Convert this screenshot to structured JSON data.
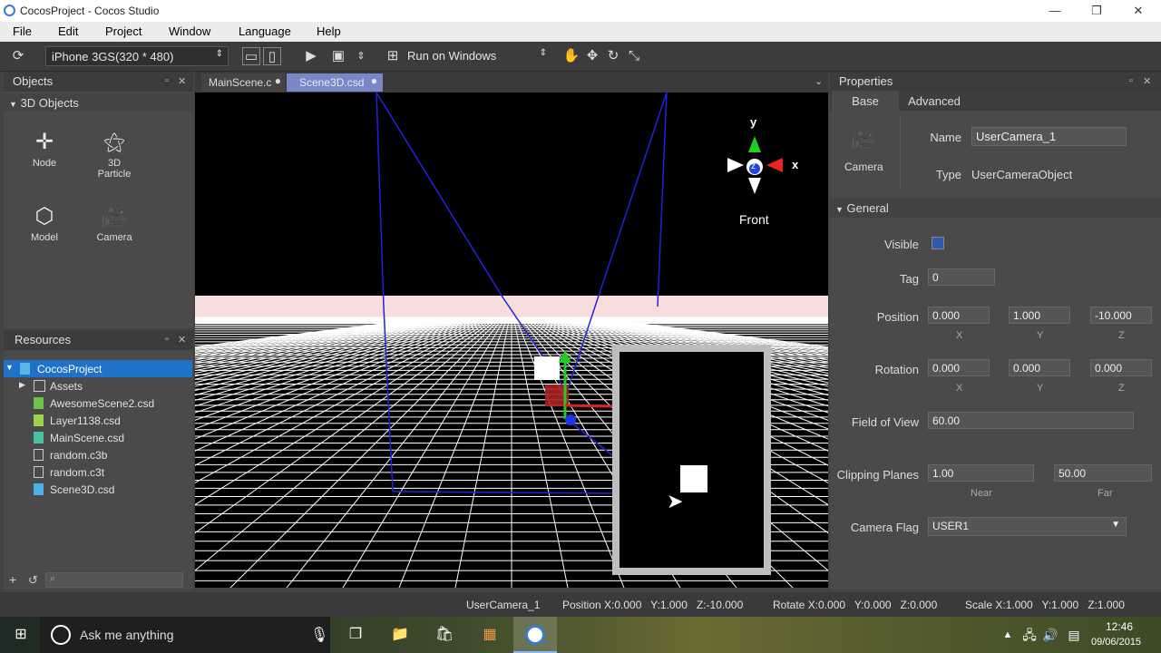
{
  "window": {
    "title": "CocosProject - Cocos Studio"
  },
  "menu": [
    "File",
    "Edit",
    "Project",
    "Window",
    "Language",
    "Help"
  ],
  "toolbar": {
    "device": "iPhone 3GS(320 * 480)",
    "run_target": "Run on Windows"
  },
  "objects_panel": {
    "title": "Objects",
    "section": "3D Objects",
    "items": [
      {
        "label": "Node",
        "icon": "node-icon"
      },
      {
        "label": "3D Particle",
        "icon": "particle-icon"
      },
      {
        "label": "Model",
        "icon": "cube-icon"
      },
      {
        "label": "Camera",
        "icon": "camera-icon"
      }
    ]
  },
  "resources_panel": {
    "title": "Resources",
    "tree": [
      {
        "label": "CocosProject",
        "type": "project",
        "selected": true
      },
      {
        "label": "Assets",
        "type": "folder"
      },
      {
        "label": "AwesomeScene2.csd",
        "type": "csd"
      },
      {
        "label": "Layer1138.csd",
        "type": "csd"
      },
      {
        "label": "MainScene.csd",
        "type": "csd"
      },
      {
        "label": "random.c3b",
        "type": "file"
      },
      {
        "label": "random.c3t",
        "type": "file"
      },
      {
        "label": "Scene3D.csd",
        "type": "csd"
      }
    ]
  },
  "tabs": [
    {
      "label": "MainScene.c",
      "active": false
    },
    {
      "label": "Scene3D.csd",
      "active": true
    }
  ],
  "viewport": {
    "gizmo_y": "y",
    "gizmo_x": "x",
    "gizmo_z": "z",
    "view_label": "Front"
  },
  "properties": {
    "title": "Properties",
    "tabs": [
      "Base",
      "Advanced"
    ],
    "type_icon_label": "Camera",
    "name_label": "Name",
    "name_value": "UserCamera_1",
    "type_label": "Type",
    "type_value": "UserCameraObject",
    "section": "General",
    "visible_label": "Visible",
    "tag_label": "Tag",
    "tag_value": "0",
    "position_label": "Position",
    "position": [
      "0.000",
      "1.000",
      "-10.000"
    ],
    "rotation_label": "Rotation",
    "rotation": [
      "0.000",
      "0.000",
      "0.000"
    ],
    "axes": [
      "X",
      "Y",
      "Z"
    ],
    "fov_label": "Field of View",
    "fov": "60.00",
    "clip_label": "Clipping Planes",
    "near": "1.00",
    "far": "50.00",
    "near_label": "Near",
    "far_label": "Far",
    "flag_label": "Camera Flag",
    "flag": "USER1"
  },
  "status": {
    "object": "UserCamera_1",
    "position": "Position X:0.000   Y:1.000   Z:-10.000",
    "rotate": "Rotate X:0.000   Y:0.000   Z:0.000",
    "scale": "Scale X:1.000   Y:1.000   Z:1.000"
  },
  "taskbar": {
    "search_placeholder": "Ask me anything",
    "time": "12:46",
    "date": "09/06/2015"
  }
}
